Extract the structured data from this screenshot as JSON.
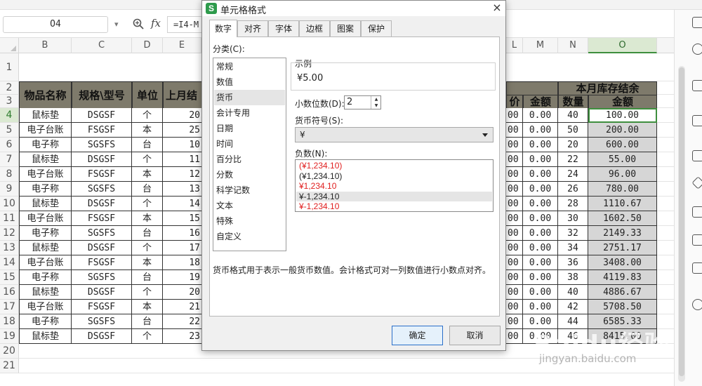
{
  "formula_bar": {
    "cell_ref": "O4",
    "fx": "fx",
    "formula": "=I4-M"
  },
  "columns": [
    {
      "id": "B"
    },
    {
      "id": "C"
    },
    {
      "id": "D"
    },
    {
      "id": "E"
    },
    {
      "id": "L"
    },
    {
      "id": "M"
    },
    {
      "id": "N"
    },
    {
      "id": "O"
    }
  ],
  "rows": [
    "1",
    "2",
    "3",
    "4",
    "5",
    "6",
    "7",
    "8",
    "9",
    "10",
    "11",
    "12",
    "13",
    "14",
    "15",
    "16",
    "17",
    "18",
    "19",
    "20",
    "21"
  ],
  "headers": {
    "item_name": "物品名称",
    "spec": "规格\\型号",
    "unit": "单位",
    "last_month": "上月结",
    "month_end": "本月库存结余",
    "price": "价",
    "amount_l": "金额",
    "qty": "数量",
    "amount": "金额"
  },
  "data_rows": [
    {
      "name": "鼠标垫",
      "spec": "DSGSF",
      "unit": "个",
      "e": "20",
      "l": "00",
      "m": "0.00",
      "n": "40",
      "o": "100.00"
    },
    {
      "name": "电子台账",
      "spec": "FSGSF",
      "unit": "本",
      "e": "25",
      "l": "00",
      "m": "0.00",
      "n": "50",
      "o": "200.00"
    },
    {
      "name": "电子称",
      "spec": "SGSFS",
      "unit": "台",
      "e": "10",
      "l": "00",
      "m": "0.00",
      "n": "20",
      "o": "600.00"
    },
    {
      "name": "鼠标垫",
      "spec": "DSGSF",
      "unit": "个",
      "e": "11",
      "l": "00",
      "m": "0.00",
      "n": "22",
      "o": "55.00"
    },
    {
      "name": "电子台账",
      "spec": "FSGSF",
      "unit": "本",
      "e": "12",
      "l": "00",
      "m": "0.00",
      "n": "24",
      "o": "96.00"
    },
    {
      "name": "电子称",
      "spec": "SGSFS",
      "unit": "台",
      "e": "13",
      "l": "00",
      "m": "0.00",
      "n": "26",
      "o": "780.00"
    },
    {
      "name": "鼠标垫",
      "spec": "DSGSF",
      "unit": "个",
      "e": "14",
      "l": "00",
      "m": "0.00",
      "n": "28",
      "o": "1110.67"
    },
    {
      "name": "电子台账",
      "spec": "FSGSF",
      "unit": "本",
      "e": "15",
      "l": "00",
      "m": "0.00",
      "n": "30",
      "o": "1602.50"
    },
    {
      "name": "电子称",
      "spec": "SGSFS",
      "unit": "台",
      "e": "16",
      "l": "00",
      "m": "0.00",
      "n": "32",
      "o": "2149.33"
    },
    {
      "name": "鼠标垫",
      "spec": "DSGSF",
      "unit": "个",
      "e": "17",
      "l": "00",
      "m": "0.00",
      "n": "34",
      "o": "2751.17"
    },
    {
      "name": "电子台账",
      "spec": "FSGSF",
      "unit": "本",
      "e": "18",
      "l": "00",
      "m": "0.00",
      "n": "36",
      "o": "3408.00"
    },
    {
      "name": "电子称",
      "spec": "SGSFS",
      "unit": "台",
      "e": "19",
      "l": "00",
      "m": "0.00",
      "n": "38",
      "o": "4119.83"
    },
    {
      "name": "鼠标垫",
      "spec": "DSGSF",
      "unit": "个",
      "e": "20",
      "l": "00",
      "m": "0.00",
      "n": "40",
      "o": "4886.67"
    },
    {
      "name": "电子台账",
      "spec": "FSGSF",
      "unit": "本",
      "e": "21",
      "l": "00",
      "m": "0.00",
      "n": "42",
      "o": "5708.50"
    },
    {
      "name": "电子称",
      "spec": "SGSFS",
      "unit": "台",
      "e": "22",
      "l": "00",
      "m": "0.00",
      "n": "44",
      "o": "6585.33"
    },
    {
      "name": "鼠标垫",
      "spec": "DSGSF",
      "unit": "个",
      "e": "23",
      "l": "00",
      "m": "0.00",
      "n": "46",
      "o": "8415.00"
    }
  ],
  "dialog": {
    "title": "单元格格式",
    "close": "×",
    "logo": "S",
    "tabs": [
      "数字",
      "对齐",
      "字体",
      "边框",
      "图案",
      "保护"
    ],
    "category_label": "分类(C):",
    "categories": [
      "常规",
      "数值",
      "货币",
      "会计专用",
      "日期",
      "时间",
      "百分比",
      "分数",
      "科学记数",
      "文本",
      "特殊",
      "自定义"
    ],
    "sample_label": "示例",
    "sample_value": "¥5.00",
    "decimals_label": "小数位数(D):",
    "decimals_value": "2",
    "symbol_label": "货币符号(S):",
    "symbol_value": "¥",
    "negative_label": "负数(N):",
    "negatives": [
      "(¥1,234.10)",
      "(¥1,234.10)",
      "¥1,234.10",
      "¥-1,234.10",
      "¥-1,234.10"
    ],
    "description": "货币格式用于表示一般货币数值。会计格式可对一列数值进行小数点对齐。",
    "ok": "确定",
    "cancel": "取消"
  },
  "watermark": {
    "text": "Baidu经验",
    "sub": "jingyan.baidu.com"
  },
  "colors": {
    "header_bg": "#7e7a6b",
    "accent_green": "#3e8f3e",
    "negative_red": "#e01e1e",
    "wps_green": "#2e9b4c"
  }
}
